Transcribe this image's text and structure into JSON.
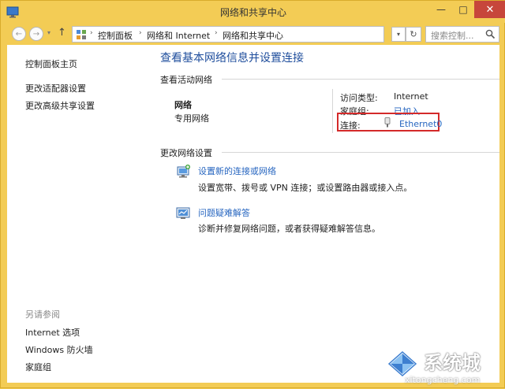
{
  "window": {
    "title": "网络和共享中心",
    "minimize": "—",
    "maximize": "□",
    "close": "✕"
  },
  "addressbar": {
    "back": "←",
    "forward": "→",
    "recent": "▾",
    "up": "↑",
    "crumbs": [
      "控制面板",
      "网络和 Internet",
      "网络和共享中心"
    ],
    "crumb_sep": "›",
    "dropdown": "▾",
    "refresh": "↻",
    "search_placeholder": "搜索控制...",
    "icon": "control-panel-icon"
  },
  "sidebar": {
    "top_links": [
      "控制面板主页",
      "更改适配器设置",
      "更改高级共享设置"
    ],
    "see_also_heading": "另请参阅",
    "see_also_links": [
      "Internet 选项",
      "Windows 防火墙",
      "家庭组"
    ]
  },
  "main": {
    "title": "查看基本网络信息并设置连接",
    "active_networks_label": "查看活动网络",
    "network": {
      "name": "网络",
      "category": "专用网络",
      "access_type_key": "访问类型:",
      "access_type_value": "Internet",
      "homegroup_key": "家庭组:",
      "homegroup_value": "已加入",
      "connections_key": "连接:",
      "connections_value": "Ethernet0"
    },
    "change_settings_label": "更改网络设置",
    "tasks": [
      {
        "link": "设置新的连接或网络",
        "desc": "设置宽带、拨号或 VPN 连接；或设置路由器或接入点。",
        "icon": "network-setup-icon"
      },
      {
        "link": "问题疑难解答",
        "desc": "诊断并修复网络问题，或者获得疑难解答信息。",
        "icon": "troubleshoot-icon"
      }
    ]
  },
  "colors": {
    "title_bar": "#f3cc55",
    "link": "#2766c0",
    "heading": "#1e4d9c",
    "highlight_box": "#d42a2a",
    "close_button": "#c7463b"
  },
  "watermark": {
    "text": "系统城",
    "sub": "xitongcheng.com"
  }
}
